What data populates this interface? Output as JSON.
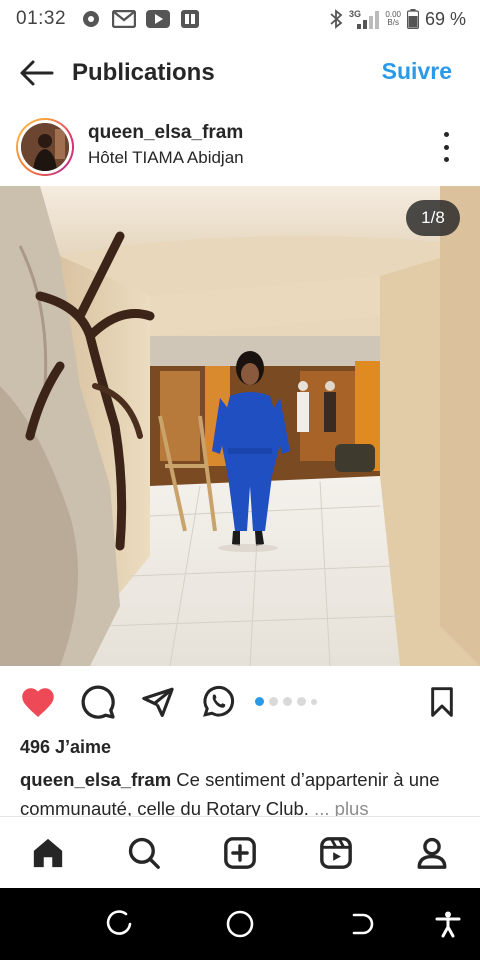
{
  "status_bar": {
    "time": "01:32",
    "network": "3G",
    "speed_top": "0.00",
    "speed_bottom": "B/s",
    "battery": "69 %",
    "icons": [
      "notification-icon",
      "gmail-icon",
      "youtube-icon",
      "app-icon",
      "bluetooth-icon",
      "signal-icon",
      "battery-icon"
    ]
  },
  "header": {
    "title": "Publications",
    "follow_label": "Suivre",
    "accent": "#2a9ae8"
  },
  "post": {
    "username": "queen_elsa_fram",
    "location": "Hôtel TIAMA Abidjan",
    "counter": "1/8",
    "carousel": {
      "total_dots": 5,
      "active_index": 0
    },
    "likes": "496 J’aime",
    "caption_user": "queen_elsa_fram",
    "caption_text": " Ce sentiment d’appartenir à une communauté, celle du Rotary Club. ",
    "caption_more": "... plus",
    "like_color": "#ed4956",
    "liked": true
  },
  "bottom_nav": {
    "items": [
      "home-icon",
      "search-icon",
      "create-icon",
      "reels-icon",
      "profile-icon"
    ],
    "active": "home-icon"
  }
}
